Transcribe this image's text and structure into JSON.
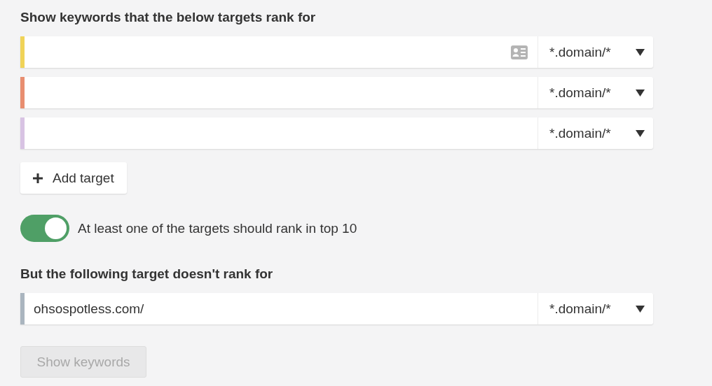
{
  "include_section": {
    "heading": "Show keywords that the below targets rank for",
    "targets": [
      {
        "color": "#f0d358",
        "card_icon": true,
        "mode": "*.domain/*"
      },
      {
        "color": "#e88e70",
        "card_icon": false,
        "mode": "*.domain/*"
      },
      {
        "color": "#d8c3e3",
        "card_icon": false,
        "mode": "*.domain/*"
      }
    ],
    "add_button": "Add target",
    "toggle": {
      "on": true,
      "label": "At least one of the targets should rank in top 10"
    }
  },
  "exclude_section": {
    "heading": "But the following target doesn't rank for",
    "targets": [
      {
        "color": "#aab5bf",
        "value": "ohsospotless.com/",
        "card_icon": false,
        "mode": "*.domain/*"
      }
    ]
  },
  "submit": {
    "label": "Show keywords",
    "disabled": true
  }
}
